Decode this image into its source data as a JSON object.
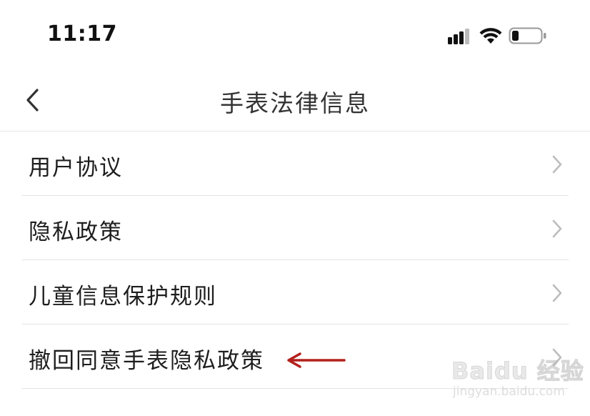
{
  "status_bar": {
    "time": "11:17",
    "icons": [
      "cellular-signal-icon",
      "wifi-icon",
      "battery-icon"
    ]
  },
  "nav": {
    "title": "手表法律信息",
    "back_icon": "chevron-left-icon"
  },
  "menu": {
    "items": [
      {
        "label": "用户协议"
      },
      {
        "label": "隐私政策"
      },
      {
        "label": "儿童信息保护规则"
      },
      {
        "label": "撤回同意手表隐私政策"
      }
    ],
    "chevron_icon": "chevron-right-icon"
  },
  "annotation": {
    "icon": "red-arrow-left-icon",
    "color": "#b3201c"
  },
  "watermark": {
    "brand": "Baidu 经验",
    "url": "jingyan.baidu.com"
  },
  "colors": {
    "background": "#ffffff",
    "text": "#1e1e1e",
    "divider": "#e3e3e3",
    "chevron": "#bdbdbd"
  }
}
